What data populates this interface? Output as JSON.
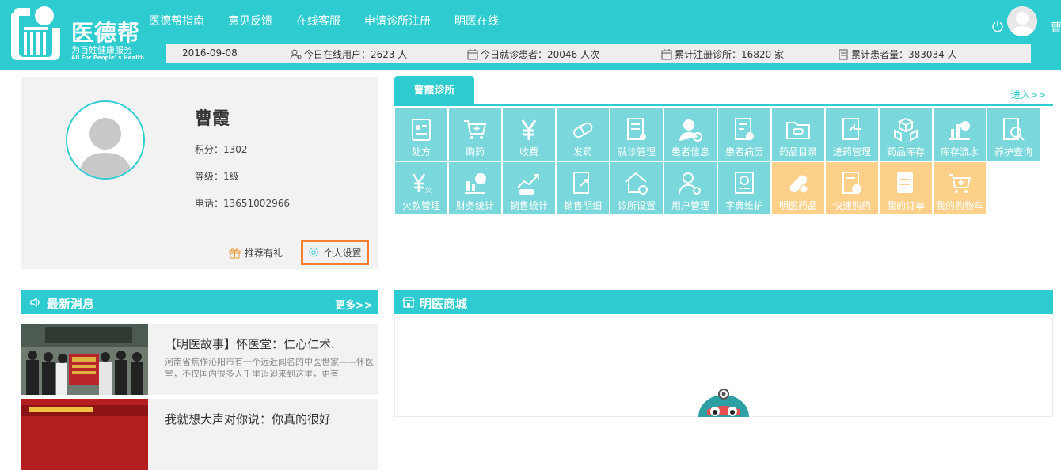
{
  "header": {
    "logo_title": "医德帮",
    "logo_subtitle": "为百姓健康服务",
    "logo_en": "All For People' s Health",
    "nav": [
      "医德帮指南",
      "意见反馈",
      "在线客服",
      "申请诊所注册",
      "明医在线"
    ],
    "user_name": "曹"
  },
  "stats": {
    "date": "2016-09-08",
    "online_users": "今日在线用户：2623 人",
    "visits_today": "今日就诊患者：20046 人次",
    "clinics_total": "累计注册诊所：16820 家",
    "patients_total": "累计患者量：383034 人"
  },
  "profile": {
    "name": "曹霞",
    "points": "积分：1302",
    "level": "等级：1级",
    "phone": "电话：13651002966",
    "recommend": "推荐有礼",
    "settings": "个人设置"
  },
  "clinic": {
    "tab": "曹霞诊所",
    "enter": "进入>>",
    "teal_color": "#7ad8dd",
    "orange_color": "#fdd08a",
    "tiles": [
      {
        "label": "处方",
        "icon": "prescription-icon",
        "tone": "teal"
      },
      {
        "label": "购药",
        "icon": "cart-icon",
        "tone": "teal"
      },
      {
        "label": "收费",
        "icon": "yen-icon",
        "tone": "teal"
      },
      {
        "label": "发药",
        "icon": "pill-icon",
        "tone": "teal"
      },
      {
        "label": "就诊管理",
        "icon": "visit-doc-icon",
        "tone": "teal"
      },
      {
        "label": "患者信息",
        "icon": "patient-icon",
        "tone": "teal"
      },
      {
        "label": "患者病历",
        "icon": "record-icon",
        "tone": "teal"
      },
      {
        "label": "药品目录",
        "icon": "folder-icon",
        "tone": "teal"
      },
      {
        "label": "进药管理",
        "icon": "stock-in-icon",
        "tone": "teal"
      },
      {
        "label": "药品库存",
        "icon": "boxes-icon",
        "tone": "teal"
      },
      {
        "label": "库存流水",
        "icon": "flow-chart-icon",
        "tone": "teal"
      },
      {
        "label": "养护查询",
        "icon": "search-doc-icon",
        "tone": "teal"
      },
      {
        "label": "欠款管理",
        "icon": "debt-icon",
        "tone": "teal"
      },
      {
        "label": "财务统计",
        "icon": "finance-icon",
        "tone": "teal"
      },
      {
        "label": "销售统计",
        "icon": "trend-icon",
        "tone": "teal"
      },
      {
        "label": "销售明细",
        "icon": "export-doc-icon",
        "tone": "teal"
      },
      {
        "label": "诊所设置",
        "icon": "home-gear-icon",
        "tone": "teal"
      },
      {
        "label": "用户管理",
        "icon": "user-gear-icon",
        "tone": "teal"
      },
      {
        "label": "字典维护",
        "icon": "dictionary-icon",
        "tone": "teal"
      },
      {
        "label": "明医药品",
        "icon": "capsule-icon",
        "tone": "orange"
      },
      {
        "label": "快速购药",
        "icon": "quick-buy-icon",
        "tone": "orange"
      },
      {
        "label": "我的订单",
        "icon": "order-icon",
        "tone": "orange"
      },
      {
        "label": "我的购物车",
        "icon": "cart-icon",
        "tone": "orange"
      }
    ]
  },
  "news": {
    "title": "最新消息",
    "more": "更多>>",
    "items": [
      {
        "title": "【明医故事】怀医堂：仁心仁术.",
        "desc": "河南省焦作沁阳市有一个远近闻名的中医世家——怀医堂，不仅国内很多人千里迢迢来到这里，更有"
      },
      {
        "title": "我就想大声对你说：你真的很好",
        "desc": ""
      }
    ]
  },
  "mall": {
    "title": "明医商城"
  }
}
